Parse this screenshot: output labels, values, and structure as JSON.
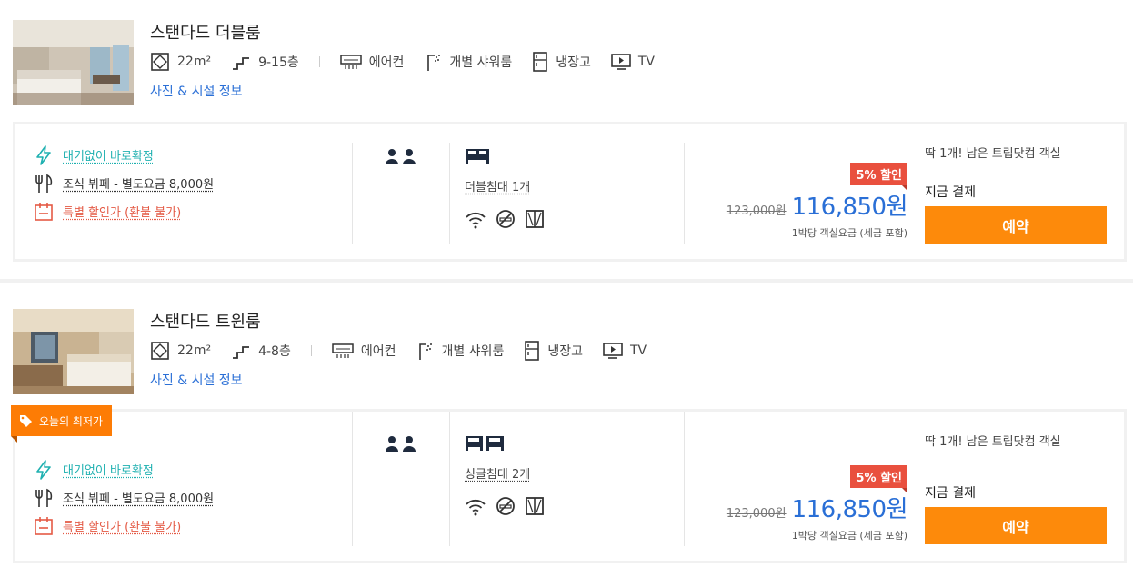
{
  "rooms": [
    {
      "name": "스탠다드 더블룸",
      "size": "22m²",
      "floors": "9-15층",
      "amenities": [
        "에어컨",
        "개별 샤워룸",
        "냉장고",
        "TV"
      ],
      "photo_link": "사진 & 시설 정보",
      "benefits": [
        "대기없이 바로확정",
        "조식 뷔페 - 별도요금 8,000원",
        "특별 할인가 (환불 불가)"
      ],
      "bed_label": "더블침대 1개",
      "discount_badge": "5% 할인",
      "original_price": "123,000원",
      "final_price": "116,850원",
      "price_note": "1박당 객실요금 (세금 포함)",
      "remaining": "딱 1개! 남은 트립닷컴 객실",
      "pay_now": "지금 결제",
      "book_label": "예약"
    },
    {
      "name": "스탠다드 트윈룸",
      "size": "22m²",
      "floors": "4-8층",
      "amenities": [
        "에어컨",
        "개별 샤워룸",
        "냉장고",
        "TV"
      ],
      "photo_link": "사진 & 시설 정보",
      "ribbon": "오늘의 최저가",
      "benefits": [
        "대기없이 바로확정",
        "조식 뷔페 - 별도요금 8,000원",
        "특별 할인가 (환불 불가)"
      ],
      "bed_label": "싱글침대 2개",
      "discount_badge": "5% 할인",
      "original_price": "123,000원",
      "final_price": "116,850원",
      "price_note": "1박당 객실요금 (세금 포함)",
      "remaining": "딱 1개! 남은 트립닷컴 객실",
      "pay_now": "지금 결제",
      "book_label": "예약"
    }
  ],
  "colors": {
    "accent_blue": "#2a6fd6",
    "book_orange": "#fd8a0b",
    "badge_red": "#e9503e",
    "teal": "#1eb0b0",
    "ribbon_orange": "#fd7c05"
  },
  "icons": [
    "room-size-icon",
    "floor-stairs-icon",
    "aircon-icon",
    "shower-icon",
    "fridge-icon",
    "tv-icon",
    "lightning-icon",
    "fork-knife-icon",
    "calendar-icon",
    "person-icon",
    "double-bed-icon",
    "single-bed-icon",
    "wifi-icon",
    "no-smoking-icon",
    "window-icon",
    "tag-icon"
  ]
}
